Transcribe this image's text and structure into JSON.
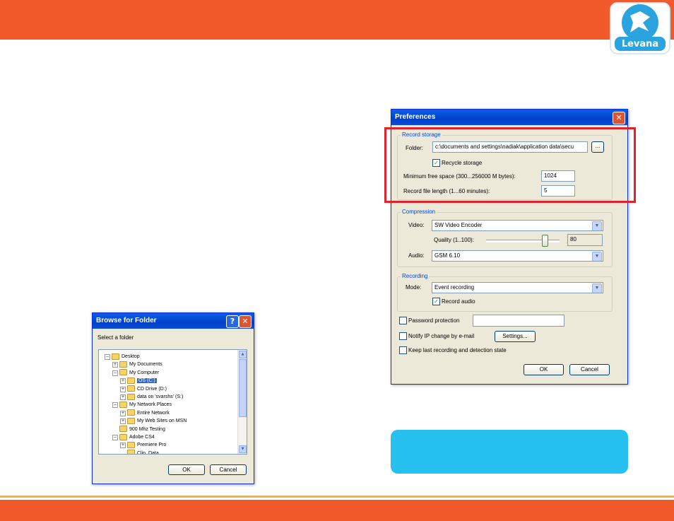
{
  "brand": {
    "logo_text": "Levana",
    "colors": {
      "orange": "#f15a2b",
      "accent": "#f7b13e",
      "callout": "#27c1f0",
      "highlight": "#e0232a"
    }
  },
  "browse": {
    "title": "Browse for Folder",
    "prompt": "Select a folder",
    "tree": [
      {
        "label": "Desktop",
        "icon": "desktop-icon"
      },
      {
        "label": "My Documents",
        "icon": "folder-icon"
      },
      {
        "label": "My Computer",
        "icon": "computer-icon"
      },
      {
        "label": "OS (C:)",
        "icon": "drive-icon"
      },
      {
        "label": "CD Drive (D:)",
        "icon": "cd-icon"
      },
      {
        "label": "data on 'svarshs' (S:)",
        "icon": "network-drive-icon"
      },
      {
        "label": "My Network Places",
        "icon": "network-icon"
      },
      {
        "label": "Entire Network",
        "icon": "globe-icon"
      },
      {
        "label": "My Web Sites on MSN",
        "icon": "msn-icon"
      },
      {
        "label": "900 Mhz Testing",
        "icon": "folder-icon"
      },
      {
        "label": "Adobe CS4",
        "icon": "folder-icon"
      },
      {
        "label": "Premiere Pro",
        "icon": "folder-icon"
      },
      {
        "label": "Clip_Data",
        "icon": "folder-icon"
      }
    ],
    "ok": "OK",
    "cancel": "Cancel"
  },
  "prefs": {
    "title": "Preferences",
    "record_storage": {
      "label": "Record storage",
      "folder_label": "Folder:",
      "folder_value": "c:\\documents and settings\\nadiak\\application data\\secu",
      "browse_button": "...",
      "recycle_label": "Recycle storage",
      "recycle_checked": true,
      "min_free_label": "Minimum free space (300...256000 M bytes):",
      "min_free_value": "1024",
      "file_length_label": "Record file length (1...60 minutes):",
      "file_length_value": "5"
    },
    "compression": {
      "label": "Compression",
      "video_label": "Video:",
      "video_value": "SW Video Encoder",
      "quality_label": "Quality (1..100):",
      "quality_value": "80",
      "quality_fraction": 0.8,
      "audio_label": "Audio:",
      "audio_value": "GSM 6.10"
    },
    "recording": {
      "label": "Recording",
      "mode_label": "Mode:",
      "mode_value": "Event recording",
      "record_audio_label": "Record audio",
      "record_audio_checked": true
    },
    "password_label": "Password protection",
    "notify_label": "Notify IP change by e-mail",
    "settings_button": "Settings...",
    "keep_label": "Keep last recording and detection state",
    "ok": "OK",
    "cancel": "Cancel"
  }
}
